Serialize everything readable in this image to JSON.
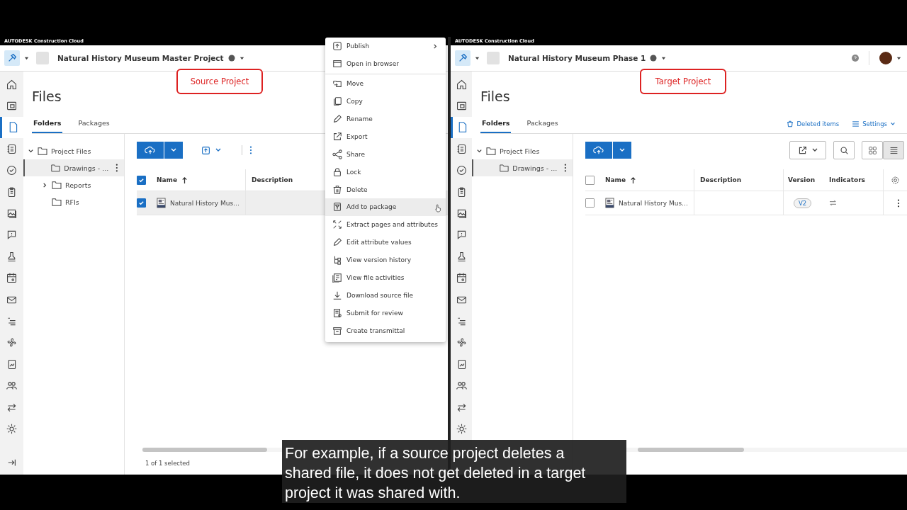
{
  "panes": [
    {
      "kind": "source",
      "brand": "AUTODESK Construction Cloud",
      "project_name": "Natural History Museum Master Project",
      "annotation": "Source Project",
      "page_title": "Files",
      "sidebar": {
        "items": [
          {
            "selected": false
          },
          {
            "selected": false
          },
          {
            "selected": true
          },
          {
            "selected": false
          },
          {
            "selected": false
          },
          {
            "selected": false
          },
          {
            "selected": false
          },
          {
            "selected": false
          },
          {
            "selected": false
          },
          {
            "selected": false
          },
          {
            "selected": false
          },
          {
            "selected": false
          },
          {
            "selected": false
          },
          {
            "selected": false
          },
          {
            "selected": false
          },
          {
            "selected": false
          },
          {
            "selected": false
          }
        ],
        "collapse_button": true
      },
      "tabs": [
        {
          "label": "Folders",
          "selected": true
        },
        {
          "label": "Packages",
          "selected": false
        }
      ],
      "tree": [
        {
          "label": "Project Files",
          "expanded": true,
          "children": [
            {
              "label": "Drawings - ...",
              "selected": true
            },
            {
              "label": "Reports",
              "expanded": false,
              "selected": false
            },
            {
              "label": "RFIs",
              "selected": false
            }
          ]
        }
      ],
      "table": {
        "all_checked": true,
        "columns": [
          "Name",
          "Description"
        ],
        "rows": [
          {
            "name": "Natural History Mus…",
            "checked": true,
            "selected": true
          }
        ]
      },
      "footer": "1 of 1 selected"
    },
    {
      "kind": "target",
      "brand": "AUTODESK Construction Cloud",
      "project_name": "Natural History Museum Phase 1",
      "annotation": "Target Project",
      "page_title": "Files",
      "sidebar": {
        "items": [
          {
            "selected": false
          },
          {
            "selected": false
          },
          {
            "selected": true
          },
          {
            "selected": false
          },
          {
            "selected": false
          },
          {
            "selected": false
          },
          {
            "selected": false
          },
          {
            "selected": false
          },
          {
            "selected": false
          },
          {
            "selected": false
          },
          {
            "selected": false
          },
          {
            "selected": false
          },
          {
            "selected": false
          },
          {
            "selected": false
          },
          {
            "selected": false
          },
          {
            "selected": false
          },
          {
            "selected": false
          }
        ]
      },
      "tabs": [
        {
          "label": "Folders",
          "selected": true
        },
        {
          "label": "Packages",
          "selected": false
        }
      ],
      "links": [
        "Deleted items",
        "Settings"
      ],
      "view_toggle": [
        {
          "selected": false
        },
        {
          "selected": true
        }
      ],
      "tree": [
        {
          "label": "Project Files",
          "expanded": true,
          "children": [
            {
              "label": "Drawings - ...",
              "selected": true
            }
          ]
        }
      ],
      "table": {
        "all_checked": false,
        "columns": [
          "Name",
          "Description",
          "Version",
          "Indicators"
        ],
        "rows": [
          {
            "name": "Natural History Mus…",
            "checked": false,
            "selected": false,
            "version": "V2"
          }
        ]
      }
    }
  ],
  "context_menu": [
    {
      "label": "Publish",
      "has_submenu": true,
      "selected": false
    },
    {
      "label": "Open in browser",
      "divider_after": true,
      "selected": false
    },
    {
      "label": "Move",
      "selected": false
    },
    {
      "label": "Copy",
      "selected": false
    },
    {
      "label": "Rename",
      "selected": false
    },
    {
      "label": "Export",
      "selected": false
    },
    {
      "label": "Share",
      "selected": false
    },
    {
      "label": "Lock",
      "selected": false
    },
    {
      "label": "Delete",
      "selected": false
    },
    {
      "label": "Add to package",
      "selected": true
    },
    {
      "label": "Extract pages and attributes",
      "selected": false
    },
    {
      "label": "Edit attribute values",
      "selected": false
    },
    {
      "label": "View version history",
      "selected": false
    },
    {
      "label": "View file activities",
      "selected": false
    },
    {
      "label": "Download source file",
      "selected": false
    },
    {
      "label": "Submit for review",
      "selected": false
    },
    {
      "label": "Create transmittal",
      "selected": false
    }
  ],
  "subtitle": "For example, if a source project deletes a\nshared file, it does not get deleted in a target\nproject it was shared with."
}
